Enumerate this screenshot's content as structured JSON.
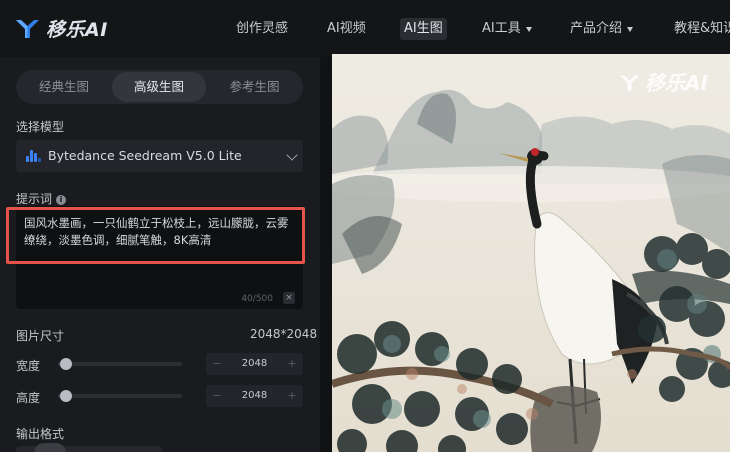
{
  "brand": {
    "name": "移乐AI",
    "accent": "#3b82f6",
    "highlight": "#e5534b"
  },
  "nav": {
    "items": [
      {
        "label": "创作灵感"
      },
      {
        "label": "AI视频"
      },
      {
        "label": "AI生图",
        "active": true
      },
      {
        "label": "AI工具",
        "dropdown": true
      },
      {
        "label": "产品介绍",
        "dropdown": true
      },
      {
        "label": "教程&知识"
      }
    ]
  },
  "modes": {
    "tabs": [
      {
        "label": "经典生图"
      },
      {
        "label": "高级生图",
        "active": true
      },
      {
        "label": "参考生图"
      }
    ]
  },
  "model": {
    "label": "选择模型",
    "value": "Bytedance Seedream V5.0 Lite",
    "icon": "bar-chart-icon"
  },
  "prompt": {
    "label": "提示词",
    "text": "国风水墨画，一只仙鹤立于松枝上，远山朦胧，云雾缭绕，淡墨色调，细腻笔触，8K高清",
    "counter": "40/500",
    "clear": "×"
  },
  "size": {
    "label": "图片尺寸",
    "value": "2048*2048",
    "width": {
      "label": "宽度",
      "value": "2048",
      "minus": "−",
      "plus": "+"
    },
    "height": {
      "label": "高度",
      "value": "2048",
      "minus": "−",
      "plus": "+"
    }
  },
  "format": {
    "label": "输出格式"
  },
  "artwork": {
    "watermark": "移乐AI",
    "subject": "crane-on-pine-ink-painting"
  }
}
